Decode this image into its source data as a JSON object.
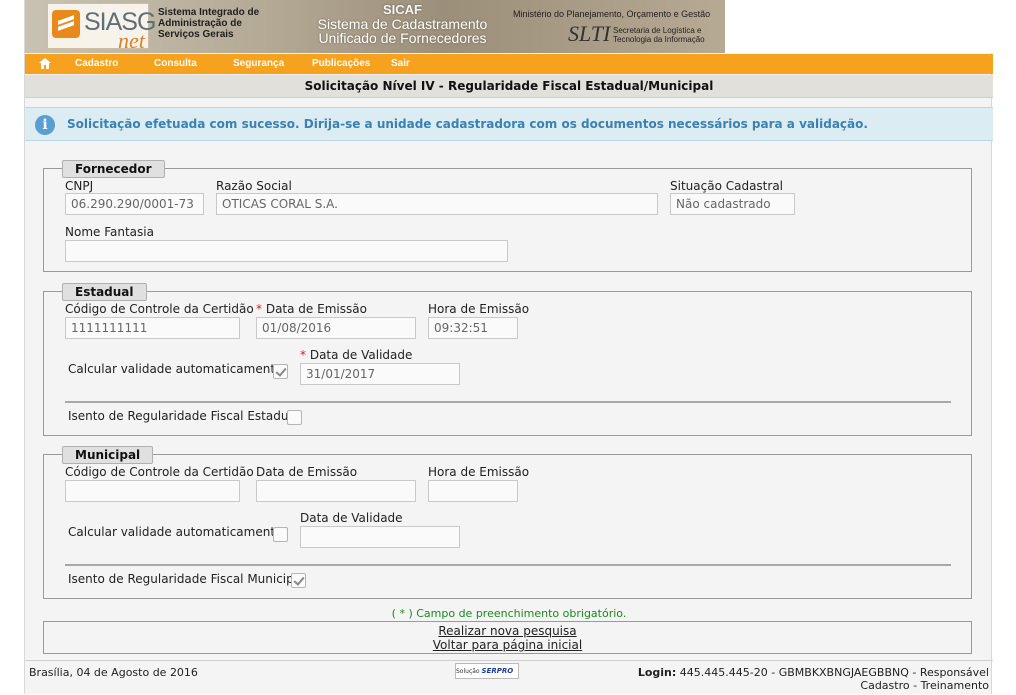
{
  "header": {
    "logo": {
      "siasg": "SIASG",
      "net": "net"
    },
    "system_name": "Sistema Integrado de\nAdministração de\nServiços Gerais",
    "sicaf_title": "SICAF",
    "sicaf_subtitle": "Sistema de Cadastramento\nUnificado de Fornecedores",
    "ministerio": "Ministério do Planejamento, Orçamento e Gestão",
    "slti": "SLTI",
    "slti_sub": "Secretaria de Logística e\nTecnologia da Informação"
  },
  "menu": {
    "items": [
      {
        "label": "Cadastro"
      },
      {
        "label": "Consulta"
      },
      {
        "label": "Segurança"
      },
      {
        "label": "Publicações"
      },
      {
        "label": "Sair"
      }
    ]
  },
  "page_title": "Solicitação Nível IV - Regularidade Fiscal Estadual/Municipal",
  "alert": {
    "text": "Solicitação efetuada com sucesso. Dirija-se a unidade cadastradora com os documentos necessários para a validação."
  },
  "fornecedor": {
    "legend": "Fornecedor",
    "cnpj_label": "CNPJ",
    "cnpj_value": "06.290.290/0001-73",
    "razao_label": "Razão Social",
    "razao_value": "OTICAS CORAL S.A.",
    "situacao_label": "Situação Cadastral",
    "situacao_value": "Não cadastrado",
    "fantasia_label": "Nome Fantasia",
    "fantasia_value": ""
  },
  "estadual": {
    "legend": "Estadual",
    "codigo_label": "Código de Controle da Certidão",
    "codigo_value": "1111111111",
    "data_emissao_label": "Data de Emissão",
    "data_emissao_value": "01/08/2016",
    "hora_label": "Hora de Emissão",
    "hora_value": "09:32:51",
    "calc_label": "Calcular validade automaticamente?",
    "calc_checked": true,
    "validade_label": "Data de Validade",
    "validade_value": "31/01/2017",
    "isento_label": "Isento de Regularidade Fiscal Estadual",
    "isento_checked": false
  },
  "municipal": {
    "legend": "Municipal",
    "codigo_label": "Código de Controle da Certidão",
    "codigo_value": "",
    "data_emissao_label": "Data de Emissão",
    "data_emissao_value": "",
    "hora_label": "Hora de Emissão",
    "hora_value": "",
    "calc_label": "Calcular validade automaticamente?",
    "calc_checked": false,
    "validade_label": "Data de Validade",
    "validade_value": "",
    "isento_label": "Isento de Regularidade Fiscal Municipal",
    "isento_checked": true
  },
  "required_asterisk": "*",
  "required_note": "( * ) Campo de preenchimento obrigatório.",
  "links": {
    "nova_pesquisa": "Realizar nova pesquisa",
    "voltar": "Voltar para página inicial"
  },
  "footer": {
    "date": "Brasília, 04 de Agosto de 2016",
    "serpro_prefix": "Solução",
    "serpro": "SERPRO",
    "login_label": "Login:",
    "login_value": "445.445.445-20 - GBMBKXBNGJAEGBBNQ - Responsável",
    "role": "Cadastro - Treinamento"
  },
  "colors": {
    "menu": "#f7a21e",
    "alert_bg": "#dcecf3",
    "alert_text": "#3b81b1",
    "required": "#d31e1e",
    "note": "#1a8a1a"
  }
}
